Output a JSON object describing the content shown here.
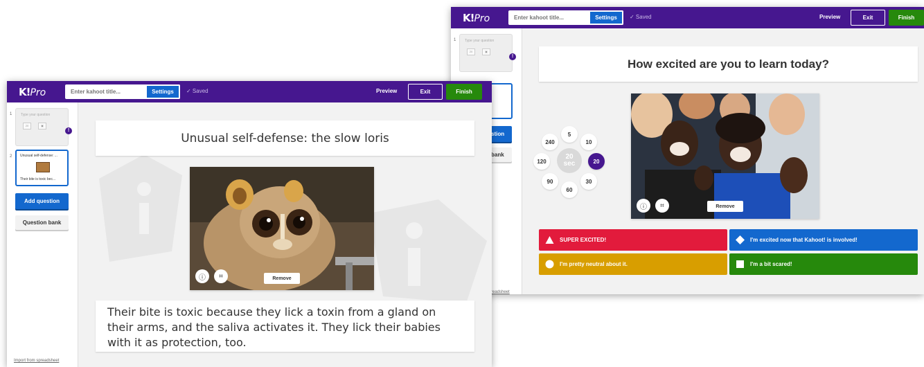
{
  "back_window": {
    "app": {
      "logo": "K!",
      "logo_suffix": "Pro",
      "title_placeholder": "Enter kahoot title...",
      "settings_label": "Settings",
      "saved_label": "✓  Saved",
      "preview_label": "Preview",
      "exit_label": "Exit",
      "finish_label": "Finish"
    },
    "sidebar": {
      "slides": [
        {
          "number": "1",
          "text": "Type your question",
          "time": "20"
        },
        {
          "number": "2",
          "text": ""
        }
      ],
      "add_question_fragment": "stion",
      "question_bank_fragment": "bank",
      "import_fragment": "readsheet"
    },
    "question": "How excited are you to learn today?",
    "timer": {
      "options": [
        "5",
        "10",
        "20",
        "30",
        "60",
        "90",
        "120",
        "240"
      ],
      "selected": "20",
      "center_value": "20",
      "center_unit": "sec"
    },
    "media": {
      "remove_label": "Remove",
      "info_icon": "info-icon",
      "crop_icon": "crop-icon"
    },
    "answers": [
      {
        "text": "SUPER EXCITED!",
        "color": "#e21b3c",
        "shape": "triangle"
      },
      {
        "text": "I'm excited now that Kahoot! is involved!",
        "color": "#1368ce",
        "shape": "diamond"
      },
      {
        "text": "I'm pretty neutral about it.",
        "color": "#d89e00",
        "shape": "circle"
      },
      {
        "text": "I'm a bit scared!",
        "color": "#26890c",
        "shape": "square"
      }
    ]
  },
  "front_window": {
    "app": {
      "logo": "K!",
      "logo_suffix": "Pro",
      "title_placeholder": "Enter kahoot title...",
      "settings_label": "Settings",
      "saved_label": "✓  Saved",
      "preview_label": "Preview",
      "exit_label": "Exit",
      "finish_label": "Finish"
    },
    "sidebar": {
      "slides": [
        {
          "number": "1",
          "text": "Type your question",
          "time": "20"
        },
        {
          "number": "2",
          "text": "Unusual self-defense: ...",
          "caption": "Their bite is toxic bec..."
        }
      ],
      "add_question_label": "Add question",
      "question_bank_label": "Question bank",
      "import_label": "Import from spreadsheet"
    },
    "question": "Unusual self-defense: the slow loris",
    "media": {
      "remove_label": "Remove",
      "info_icon": "info-icon",
      "crop_icon": "crop-icon"
    },
    "explanation": "Their bite is toxic because they lick a toxin from a gland on their arms, and the saliva activates it. They lick their babies with it as protection, too."
  },
  "colors": {
    "brand_purple": "#46178f",
    "blue": "#1368ce",
    "green": "#26890c",
    "red": "#e21b3c",
    "yellow": "#d89e00"
  }
}
